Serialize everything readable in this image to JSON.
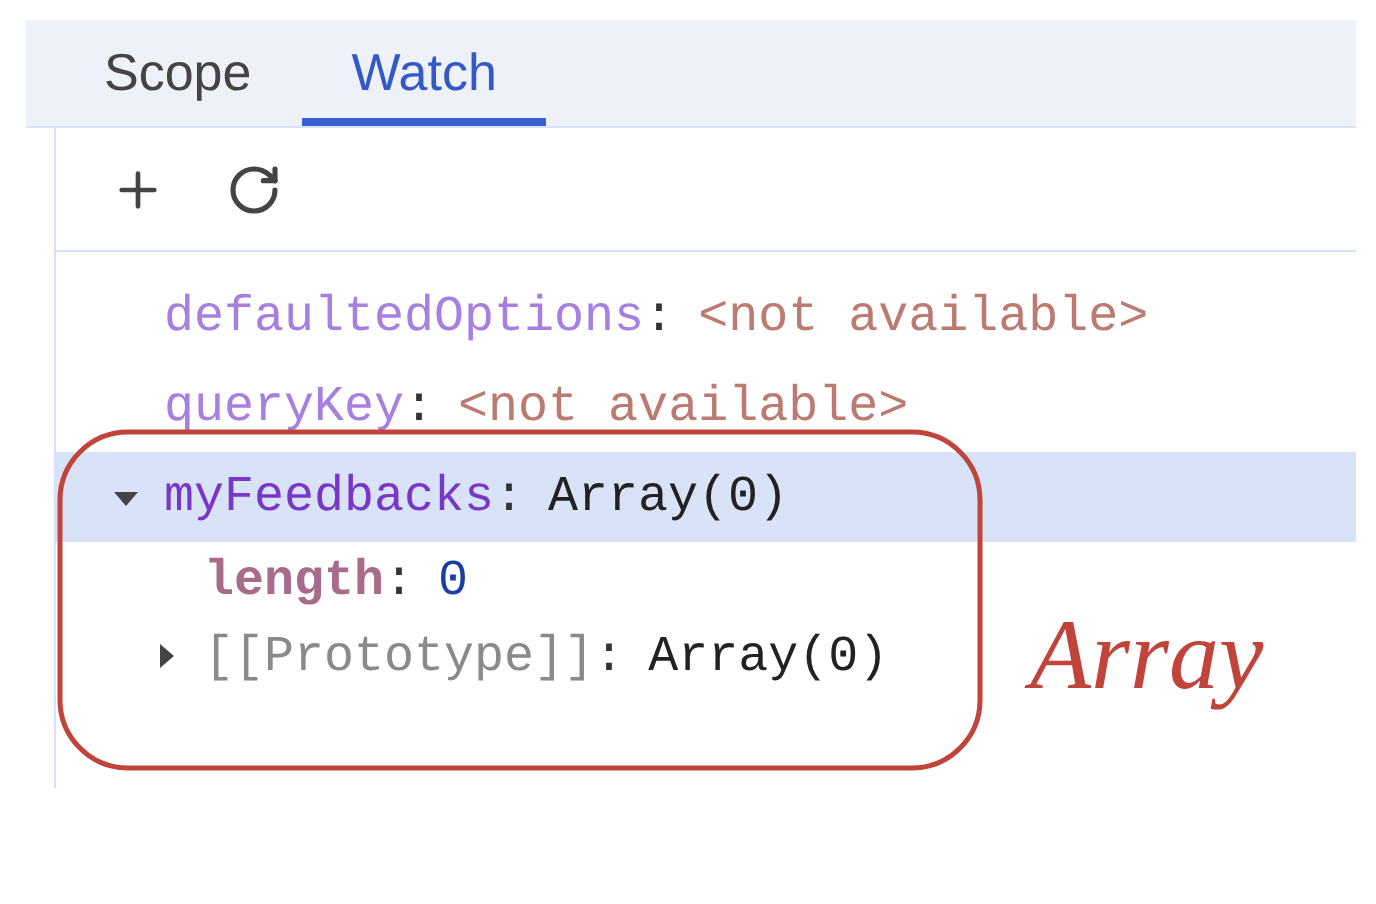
{
  "tabs": [
    {
      "label": "Scope",
      "selected": false
    },
    {
      "label": "Watch",
      "selected": true
    }
  ],
  "watch": [
    {
      "name": "defaultedOptions",
      "colon": ":",
      "value": "<not available>",
      "kind": "unavailable",
      "selected": false
    },
    {
      "name": "queryKey",
      "colon": ":",
      "value": "<not available>",
      "kind": "unavailable",
      "selected": false
    },
    {
      "name": "myFeedbacks",
      "colon": ":",
      "value": "Array(0)",
      "kind": "object",
      "expanded": true,
      "selected": true,
      "children": [
        {
          "name": "length",
          "colon": ":",
          "value": "0",
          "kind": "number"
        },
        {
          "name": "[[Prototype]]",
          "colon": ":",
          "value": "Array(0)",
          "kind": "internal",
          "expanded": false
        }
      ]
    }
  ],
  "annotation": {
    "label": "Array"
  }
}
